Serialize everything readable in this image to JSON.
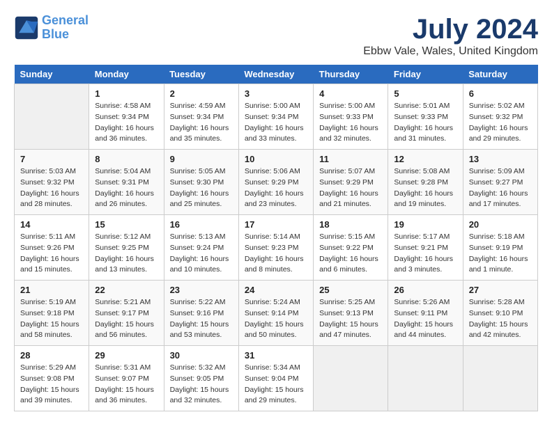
{
  "logo": {
    "line1": "General",
    "line2": "Blue"
  },
  "title": "July 2024",
  "location": "Ebbw Vale, Wales, United Kingdom",
  "days_of_week": [
    "Sunday",
    "Monday",
    "Tuesday",
    "Wednesday",
    "Thursday",
    "Friday",
    "Saturday"
  ],
  "weeks": [
    [
      {
        "num": "",
        "sunrise": "",
        "sunset": "",
        "daylight": "",
        "empty": true
      },
      {
        "num": "1",
        "sunrise": "Sunrise: 4:58 AM",
        "sunset": "Sunset: 9:34 PM",
        "daylight": "Daylight: 16 hours and 36 minutes."
      },
      {
        "num": "2",
        "sunrise": "Sunrise: 4:59 AM",
        "sunset": "Sunset: 9:34 PM",
        "daylight": "Daylight: 16 hours and 35 minutes."
      },
      {
        "num": "3",
        "sunrise": "Sunrise: 5:00 AM",
        "sunset": "Sunset: 9:34 PM",
        "daylight": "Daylight: 16 hours and 33 minutes."
      },
      {
        "num": "4",
        "sunrise": "Sunrise: 5:00 AM",
        "sunset": "Sunset: 9:33 PM",
        "daylight": "Daylight: 16 hours and 32 minutes."
      },
      {
        "num": "5",
        "sunrise": "Sunrise: 5:01 AM",
        "sunset": "Sunset: 9:33 PM",
        "daylight": "Daylight: 16 hours and 31 minutes."
      },
      {
        "num": "6",
        "sunrise": "Sunrise: 5:02 AM",
        "sunset": "Sunset: 9:32 PM",
        "daylight": "Daylight: 16 hours and 29 minutes."
      }
    ],
    [
      {
        "num": "7",
        "sunrise": "Sunrise: 5:03 AM",
        "sunset": "Sunset: 9:32 PM",
        "daylight": "Daylight: 16 hours and 28 minutes."
      },
      {
        "num": "8",
        "sunrise": "Sunrise: 5:04 AM",
        "sunset": "Sunset: 9:31 PM",
        "daylight": "Daylight: 16 hours and 26 minutes."
      },
      {
        "num": "9",
        "sunrise": "Sunrise: 5:05 AM",
        "sunset": "Sunset: 9:30 PM",
        "daylight": "Daylight: 16 hours and 25 minutes."
      },
      {
        "num": "10",
        "sunrise": "Sunrise: 5:06 AM",
        "sunset": "Sunset: 9:29 PM",
        "daylight": "Daylight: 16 hours and 23 minutes."
      },
      {
        "num": "11",
        "sunrise": "Sunrise: 5:07 AM",
        "sunset": "Sunset: 9:29 PM",
        "daylight": "Daylight: 16 hours and 21 minutes."
      },
      {
        "num": "12",
        "sunrise": "Sunrise: 5:08 AM",
        "sunset": "Sunset: 9:28 PM",
        "daylight": "Daylight: 16 hours and 19 minutes."
      },
      {
        "num": "13",
        "sunrise": "Sunrise: 5:09 AM",
        "sunset": "Sunset: 9:27 PM",
        "daylight": "Daylight: 16 hours and 17 minutes."
      }
    ],
    [
      {
        "num": "14",
        "sunrise": "Sunrise: 5:11 AM",
        "sunset": "Sunset: 9:26 PM",
        "daylight": "Daylight: 16 hours and 15 minutes."
      },
      {
        "num": "15",
        "sunrise": "Sunrise: 5:12 AM",
        "sunset": "Sunset: 9:25 PM",
        "daylight": "Daylight: 16 hours and 13 minutes."
      },
      {
        "num": "16",
        "sunrise": "Sunrise: 5:13 AM",
        "sunset": "Sunset: 9:24 PM",
        "daylight": "Daylight: 16 hours and 10 minutes."
      },
      {
        "num": "17",
        "sunrise": "Sunrise: 5:14 AM",
        "sunset": "Sunset: 9:23 PM",
        "daylight": "Daylight: 16 hours and 8 minutes."
      },
      {
        "num": "18",
        "sunrise": "Sunrise: 5:15 AM",
        "sunset": "Sunset: 9:22 PM",
        "daylight": "Daylight: 16 hours and 6 minutes."
      },
      {
        "num": "19",
        "sunrise": "Sunrise: 5:17 AM",
        "sunset": "Sunset: 9:21 PM",
        "daylight": "Daylight: 16 hours and 3 minutes."
      },
      {
        "num": "20",
        "sunrise": "Sunrise: 5:18 AM",
        "sunset": "Sunset: 9:19 PM",
        "daylight": "Daylight: 16 hours and 1 minute."
      }
    ],
    [
      {
        "num": "21",
        "sunrise": "Sunrise: 5:19 AM",
        "sunset": "Sunset: 9:18 PM",
        "daylight": "Daylight: 15 hours and 58 minutes."
      },
      {
        "num": "22",
        "sunrise": "Sunrise: 5:21 AM",
        "sunset": "Sunset: 9:17 PM",
        "daylight": "Daylight: 15 hours and 56 minutes."
      },
      {
        "num": "23",
        "sunrise": "Sunrise: 5:22 AM",
        "sunset": "Sunset: 9:16 PM",
        "daylight": "Daylight: 15 hours and 53 minutes."
      },
      {
        "num": "24",
        "sunrise": "Sunrise: 5:24 AM",
        "sunset": "Sunset: 9:14 PM",
        "daylight": "Daylight: 15 hours and 50 minutes."
      },
      {
        "num": "25",
        "sunrise": "Sunrise: 5:25 AM",
        "sunset": "Sunset: 9:13 PM",
        "daylight": "Daylight: 15 hours and 47 minutes."
      },
      {
        "num": "26",
        "sunrise": "Sunrise: 5:26 AM",
        "sunset": "Sunset: 9:11 PM",
        "daylight": "Daylight: 15 hours and 44 minutes."
      },
      {
        "num": "27",
        "sunrise": "Sunrise: 5:28 AM",
        "sunset": "Sunset: 9:10 PM",
        "daylight": "Daylight: 15 hours and 42 minutes."
      }
    ],
    [
      {
        "num": "28",
        "sunrise": "Sunrise: 5:29 AM",
        "sunset": "Sunset: 9:08 PM",
        "daylight": "Daylight: 15 hours and 39 minutes."
      },
      {
        "num": "29",
        "sunrise": "Sunrise: 5:31 AM",
        "sunset": "Sunset: 9:07 PM",
        "daylight": "Daylight: 15 hours and 36 minutes."
      },
      {
        "num": "30",
        "sunrise": "Sunrise: 5:32 AM",
        "sunset": "Sunset: 9:05 PM",
        "daylight": "Daylight: 15 hours and 32 minutes."
      },
      {
        "num": "31",
        "sunrise": "Sunrise: 5:34 AM",
        "sunset": "Sunset: 9:04 PM",
        "daylight": "Daylight: 15 hours and 29 minutes."
      },
      {
        "num": "",
        "sunrise": "",
        "sunset": "",
        "daylight": "",
        "empty": true
      },
      {
        "num": "",
        "sunrise": "",
        "sunset": "",
        "daylight": "",
        "empty": true
      },
      {
        "num": "",
        "sunrise": "",
        "sunset": "",
        "daylight": "",
        "empty": true
      }
    ]
  ]
}
